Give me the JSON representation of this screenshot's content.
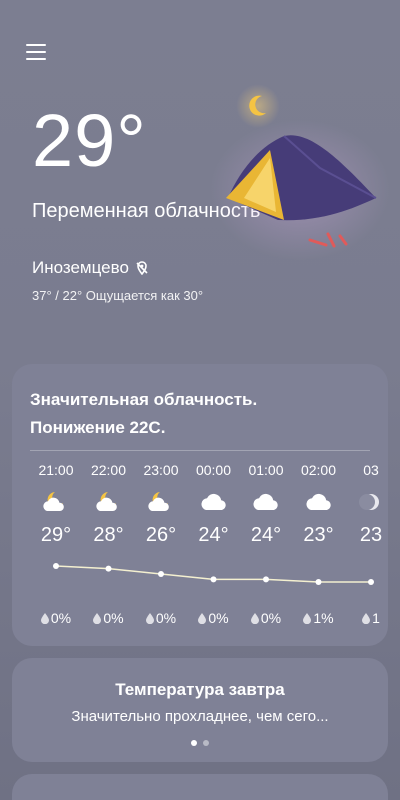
{
  "current": {
    "temperature": "29°",
    "condition": "Переменная облачность",
    "location": "Иноземцево",
    "minmax_feels": "37° / 22° Ощущается как 30°"
  },
  "hourly": {
    "summary_line1": "Значительная облачность.",
    "summary_line2": "Понижение 22C.",
    "items": [
      {
        "time": "21:00",
        "icon": "moon-cloud-icon",
        "temp": "29°",
        "precip": "0%"
      },
      {
        "time": "22:00",
        "icon": "moon-cloud-icon",
        "temp": "28°",
        "precip": "0%"
      },
      {
        "time": "23:00",
        "icon": "moon-cloud-icon",
        "temp": "26°",
        "precip": "0%"
      },
      {
        "time": "00:00",
        "icon": "cloud-icon",
        "temp": "24°",
        "precip": "0%"
      },
      {
        "time": "01:00",
        "icon": "cloud-icon",
        "temp": "24°",
        "precip": "0%"
      },
      {
        "time": "02:00",
        "icon": "cloud-icon",
        "temp": "23°",
        "precip": "1%"
      },
      {
        "time": "03",
        "icon": "moon-icon",
        "temp": "23",
        "precip": "1"
      }
    ],
    "temps_numeric": [
      29,
      28,
      26,
      24,
      24,
      23,
      23
    ]
  },
  "tomorrow": {
    "title": "Температура завтра",
    "text": "Значительно прохладнее, чем сего..."
  },
  "colors": {
    "background": "#7b7d90",
    "card": "#7f8196",
    "tent": "#4a3f7a",
    "tent_light": "#f2c94c",
    "moon": "#f5c443",
    "alarm": "#e05a5a"
  }
}
